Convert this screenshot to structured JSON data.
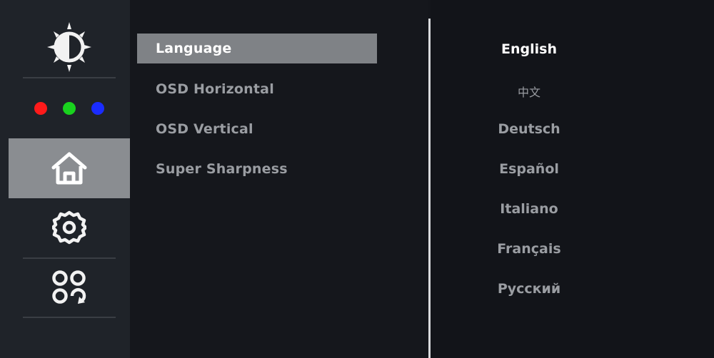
{
  "sidebar": {
    "items": [
      {
        "icon": "brightness-contrast-icon",
        "selected": false
      },
      {
        "icon": "rgb-color-icon",
        "selected": false,
        "dot_colors": [
          "#ff1a1a",
          "#19d21e",
          "#1a2cff"
        ]
      },
      {
        "icon": "home-icon",
        "selected": true
      },
      {
        "icon": "gear-icon",
        "selected": false
      },
      {
        "icon": "other-settings-icon",
        "selected": false
      }
    ]
  },
  "menu": {
    "items": [
      {
        "label": "Language",
        "active": true
      },
      {
        "label": "OSD Horizontal",
        "active": false
      },
      {
        "label": "OSD Vertical",
        "active": false
      },
      {
        "label": "Super Sharpness",
        "active": false
      }
    ]
  },
  "options": {
    "items": [
      {
        "label": "English",
        "selected": true
      },
      {
        "label": "中文",
        "selected": false
      },
      {
        "label": "Deutsch",
        "selected": false
      },
      {
        "label": "Español",
        "selected": false
      },
      {
        "label": "Italiano",
        "selected": false
      },
      {
        "label": "Français",
        "selected": false
      },
      {
        "label": "Русский",
        "selected": false
      }
    ]
  },
  "colors": {
    "selected_bg": "#8a8d91",
    "active_menu_bg": "#7f8286",
    "text_normal": "#9a9da2",
    "text_selected": "#ffffff"
  }
}
